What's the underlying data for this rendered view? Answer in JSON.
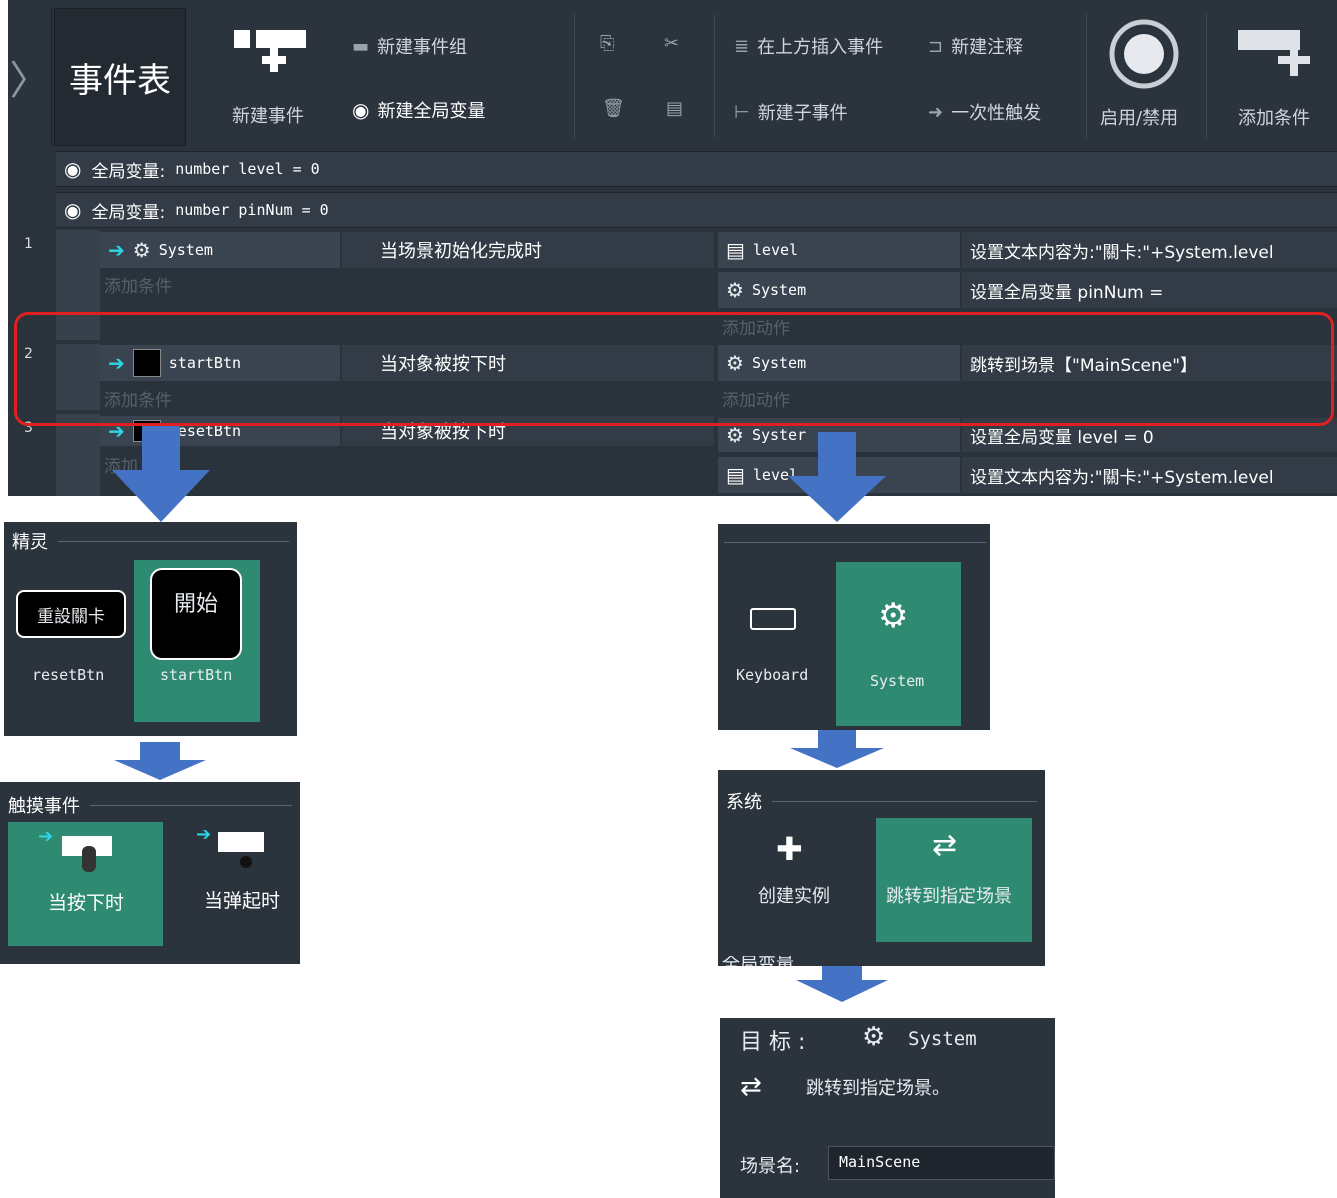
{
  "toolbar": {
    "title": "事件表",
    "new_event": "新建事件",
    "new_event_group": "新建事件组",
    "new_global_var": "新建全局变量",
    "insert_above": "在上方插入事件",
    "new_comment": "新建注释",
    "new_sub_event": "新建子事件",
    "trigger_once": "一次性触发",
    "enable_disable": "启用/禁用",
    "add_condition": "添加条件"
  },
  "globals": [
    {
      "label": "全局变量:",
      "code": "number  level = 0"
    },
    {
      "label": "全局变量:",
      "code": "number  pinNum = 0"
    }
  ],
  "events": [
    {
      "num": "1",
      "obj": "System",
      "cond": "当场景初始化完成时",
      "add_cond": "添加条件",
      "add_action": "添加动作",
      "actions": [
        {
          "obj": "level",
          "text": "设置文本内容为:\"關卡:\"+System.level"
        },
        {
          "obj": "System",
          "text": "设置全局变量 pinNum ="
        }
      ]
    },
    {
      "num": "2",
      "obj": "startBtn",
      "cond": "当对象被按下时",
      "add_cond": "添加条件",
      "add_action": "添加动作",
      "actions": [
        {
          "obj": "System",
          "text": "跳转到场景【\"MainScene\"】"
        }
      ]
    },
    {
      "num": "3",
      "obj": "resetBtn",
      "cond": "当对象被按下时",
      "add_cond": "添加",
      "actions": [
        {
          "obj": "Syster",
          "text": "设置全局变量 level = 0"
        },
        {
          "obj": "level",
          "text": "设置文本内容为:\"關卡:\"+System.level"
        }
      ]
    }
  ],
  "sprite_panel": {
    "header": "精灵",
    "items": [
      {
        "label": "resetBtn",
        "thumb": "重設關卡"
      },
      {
        "label": "startBtn",
        "thumb": "開始"
      }
    ]
  },
  "touch_panel": {
    "header": "触摸事件",
    "items": [
      {
        "label": "当按下时"
      },
      {
        "label": "当弹起时"
      }
    ]
  },
  "object_panel": {
    "items": [
      {
        "label": "Keyboard"
      },
      {
        "label": "System"
      }
    ]
  },
  "system_panel": {
    "header": "系统",
    "items": [
      {
        "label": "创建实例"
      },
      {
        "label": "跳转到指定场景"
      }
    ],
    "footer_partial": "全局变量"
  },
  "target_panel": {
    "target_label": "目 标 :",
    "target_obj": "System",
    "action_desc": "跳转到指定场景。",
    "field_label": "场景名:",
    "field_value": "MainScene"
  },
  "colors": {
    "highlight": "#e02020",
    "arrow": "#4472c4",
    "selected": "#2e8b72"
  }
}
